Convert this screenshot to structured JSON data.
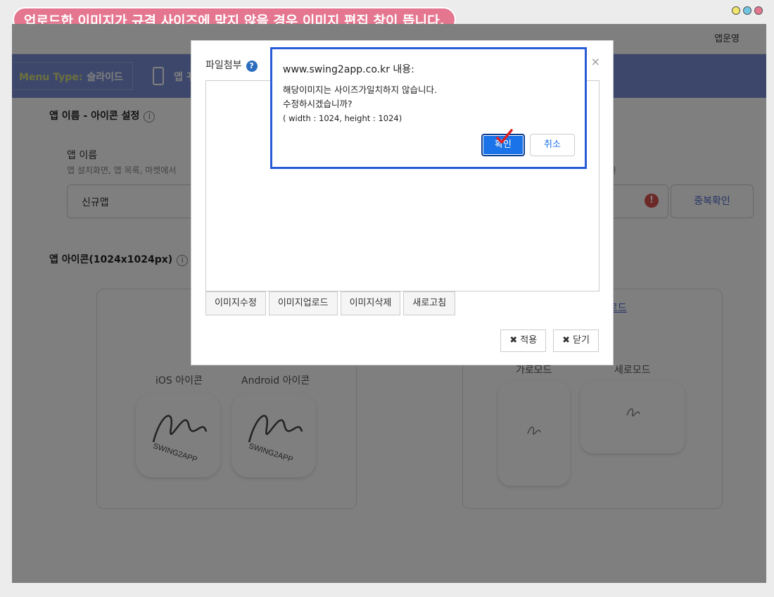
{
  "banner": {
    "text": "업로드한 이미지가 규격 사이즈에 맞지 않을 경우 이미지 편집 창이 뜹니다."
  },
  "window_dots": {
    "colors": [
      "#f2e56b",
      "#6fc6e3",
      "#e5768f"
    ]
  },
  "header": {
    "user": "앱운영"
  },
  "nav": {
    "menu_type_key": "Menu Type:",
    "menu_type_value": "슬라이드",
    "item_label": "앱 꾸"
  },
  "app_name_section": {
    "title": "앱 이름 - 아이콘 설정",
    "label": "앱 이름",
    "sub": "앱 설치화면, 앱 목록, 마켓에서",
    "sub_right": "다",
    "value": "신규앱",
    "dup_button": "중복확인"
  },
  "icon_section": {
    "title": "앱 아이콘(1024x1024px)",
    "ios_label": "iOS 아이콘",
    "android_label": "Android 아이콘",
    "upload_link": "로드",
    "landscape_label": "가로모드",
    "portrait_label": "세로모드"
  },
  "editor": {
    "title": "파일첨부",
    "help_icon": "?",
    "close": "×",
    "tools": [
      "이미지수정",
      "이미지업로드",
      "이미지삭제",
      "새로고침"
    ],
    "apply": "적용",
    "close_btn": "닫기"
  },
  "alert": {
    "title": "www.swing2app.co.kr 내용:",
    "line1": "해당이미지는 사이즈가일치하지 않습니다.",
    "line2": "수정하시겠습니까?",
    "line3": "( width : 1024, height : 1024)",
    "ok": "확인",
    "cancel": "취소"
  }
}
